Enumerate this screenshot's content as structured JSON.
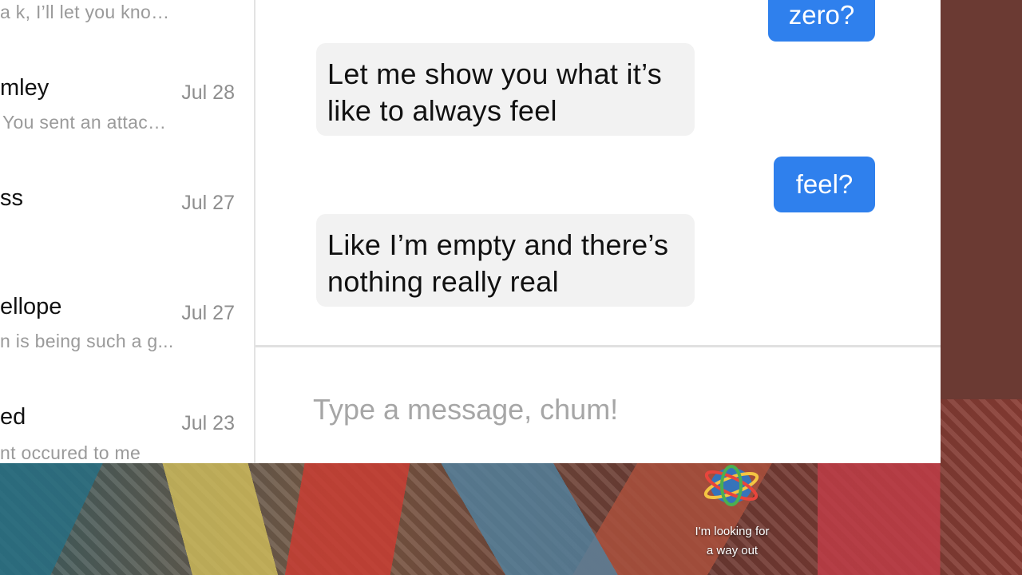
{
  "conversations": [
    {
      "name": "",
      "preview": "a k, I’ll let you kno…",
      "date": ""
    },
    {
      "name": "mley",
      "preview": "You sent an attac…",
      "date": "Jul 28"
    },
    {
      "name": "ss",
      "preview": "",
      "date": "Jul 27"
    },
    {
      "name": "ellope",
      "preview": "n is being such a g...",
      "date": "Jul 27"
    },
    {
      "name": "ed",
      "preview": "nt occured to me",
      "date": "Jul 23"
    }
  ],
  "messages": [
    {
      "direction": "outgoing",
      "text": "zero?"
    },
    {
      "direction": "incoming",
      "line1": "Let me show you what it’s",
      "line2": "like to always feel"
    },
    {
      "direction": "outgoing",
      "text": "feel?"
    },
    {
      "direction": "incoming",
      "line1": "Like I’m empty and there’s",
      "line2": "nothing really real"
    }
  ],
  "composer": {
    "placeholder": "Type a message, chum!"
  },
  "video_caption": {
    "line1": "I'm looking for",
    "line2": "a way out"
  },
  "colors": {
    "outgoing_bubble": "#2f80ed",
    "incoming_bubble": "#f2f2f2",
    "placeholder": "#a6a6a6"
  },
  "icons": {
    "caption_logo": "globe-logo-icon"
  }
}
